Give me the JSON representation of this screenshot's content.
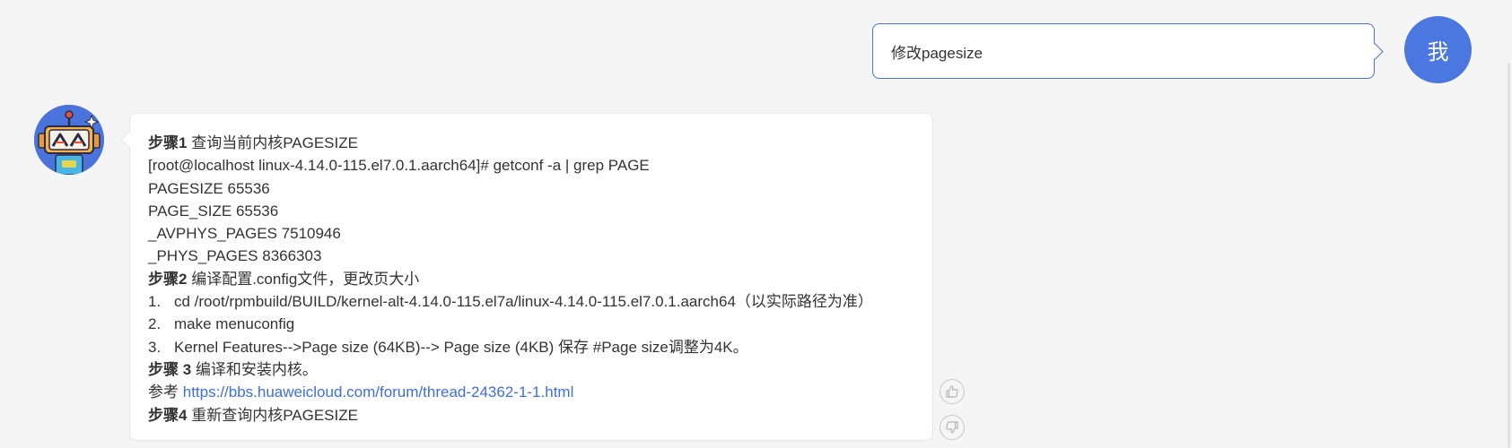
{
  "user": {
    "message": "修改pagesize",
    "avatar_text": "我"
  },
  "bot": {
    "avatar_icon": "robot-icon",
    "lines": [
      {
        "bold": "步骤1",
        "text": " 查询当前内核PAGESIZE"
      },
      {
        "text": "[root@localhost linux-4.14.0-115.el7.0.1.aarch64]# getconf -a | grep PAGE"
      },
      {
        "text": "PAGESIZE 65536"
      },
      {
        "text": "PAGE_SIZE 65536"
      },
      {
        "text": "_AVPHYS_PAGES 7510946"
      },
      {
        "text": "_PHYS_PAGES 8366303"
      },
      {
        "bold": "步骤2",
        "text": " 编译配置.config文件，更改页大小"
      },
      {
        "num": "1.",
        "text": "cd /root/rpmbuild/BUILD/kernel-alt-4.14.0-115.el7a/linux-4.14.0-115.el7.0.1.aarch64（以实际路径为准）"
      },
      {
        "num": "2.",
        "text": "make menuconfig"
      },
      {
        "num": "3.",
        "text": "Kernel Features-->Page size (64KB)--> Page size (4KB) 保存 #Page size调整为4K。"
      },
      {
        "bold": "步骤 3",
        "text": " 编译和安装内核。"
      },
      {
        "text": "参考 ",
        "link": "https://bbs.huaweicloud.com/forum/thread-24362-1-1.html"
      },
      {
        "bold": "步骤4",
        "text": " 重新查询内核PAGESIZE"
      }
    ]
  },
  "feedback": {
    "like_icon": "thumbs-up-icon",
    "dislike_icon": "thumbs-down-icon"
  }
}
